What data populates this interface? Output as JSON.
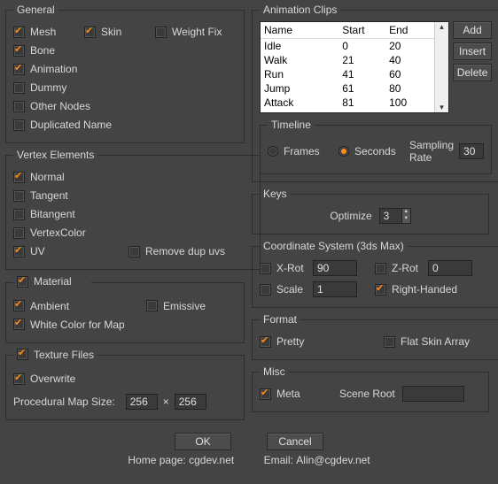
{
  "general": {
    "legend": "General",
    "mesh": "Mesh",
    "skin": "Skin",
    "weightfix": "Weight Fix",
    "bone": "Bone",
    "animation": "Animation",
    "dummy": "Dummy",
    "othernodes": "Other Nodes",
    "dupname": "Duplicated Name"
  },
  "vertex": {
    "legend": "Vertex Elements",
    "normal": "Normal",
    "tangent": "Tangent",
    "bitangent": "Bitangent",
    "vertexcolor": "VertexColor",
    "uv": "UV",
    "removedup": "Remove dup uvs"
  },
  "material": {
    "legend": "Material",
    "ambient": "Ambient",
    "emissive": "Emissive",
    "whitecolor": "White Color for Map"
  },
  "texture": {
    "legend": "Texture Files",
    "overwrite": "Overwrite",
    "procmap_label": "Procedural Map Size:",
    "size_w": "256",
    "size_h": "256",
    "times": "×"
  },
  "animclips": {
    "legend": "Animation Clips",
    "cols": {
      "name": "Name",
      "start": "Start",
      "end": "End"
    },
    "rows": [
      {
        "name": "Idle",
        "start": "0",
        "end": "20"
      },
      {
        "name": "Walk",
        "start": "21",
        "end": "40"
      },
      {
        "name": "Run",
        "start": "41",
        "end": "60"
      },
      {
        "name": "Jump",
        "start": "61",
        "end": "80"
      },
      {
        "name": "Attack",
        "start": "81",
        "end": "100"
      }
    ],
    "btn_add": "Add",
    "btn_insert": "Insert",
    "btn_delete": "Delete"
  },
  "timeline": {
    "legend": "Timeline",
    "frames": "Frames",
    "seconds": "Seconds",
    "sampling_label": "Sampling Rate",
    "sampling_value": "30"
  },
  "keys": {
    "legend": "Keys",
    "optimize": "Optimize",
    "value": "3"
  },
  "coord": {
    "legend": "Coordinate System (3ds Max)",
    "xrot": "X-Rot",
    "xrot_val": "90",
    "zrot": "Z-Rot",
    "zrot_val": "0",
    "scale": "Scale",
    "scale_val": "1",
    "righthanded": "Right-Handed"
  },
  "format": {
    "legend": "Format",
    "pretty": "Pretty",
    "flatskin": "Flat Skin Array"
  },
  "misc": {
    "legend": "Misc",
    "meta": "Meta",
    "sceneroot": "Scene Root",
    "sceneroot_val": ""
  },
  "buttons": {
    "ok": "OK",
    "cancel": "Cancel"
  },
  "footer": {
    "home_label": "Home page:",
    "home_val": "cgdev.net",
    "email_label": "Email:",
    "email_val": "Alin@cgdev.net"
  }
}
